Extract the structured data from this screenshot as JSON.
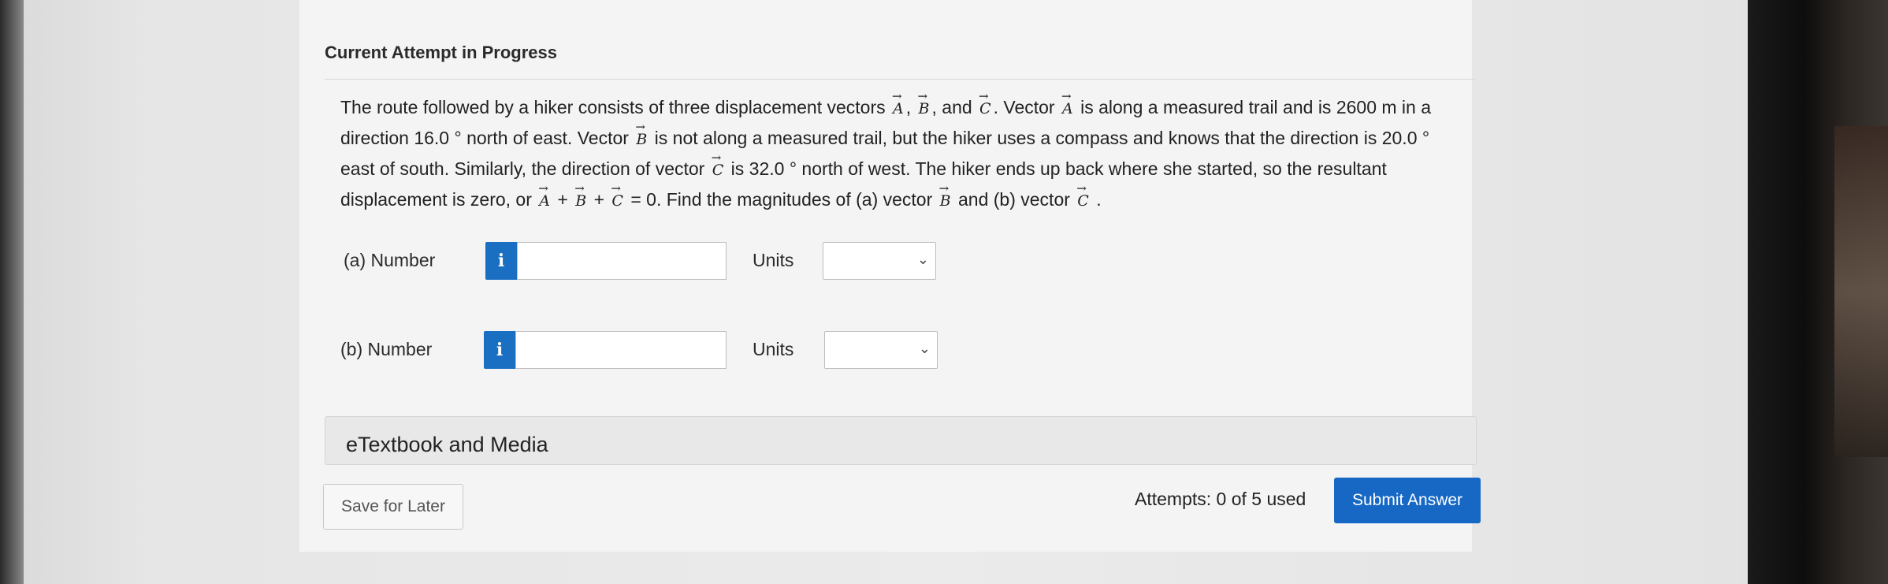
{
  "header": {
    "title": "Current Attempt in Progress"
  },
  "question": {
    "seg1": "The route followed by a hiker consists of three displacement vectors ",
    "seg2": ", ",
    "seg3": ", and ",
    "seg4": ". Vector ",
    "seg5": " is along a measured trail and is 2600 m in a direction 16.0 ° north of east. Vector ",
    "seg6": " is not along a measured trail, but the hiker uses a compass and knows that the direction is 20.0 ° east of south. Similarly, the direction of vector ",
    "seg7": " is 32.0 ° north of west. The hiker ends up back where she started, so the resultant displacement is zero, or ",
    "seg8": " + ",
    "seg9": " + ",
    "seg10": " = 0. Find the magnitudes of (a) vector ",
    "seg11": " and (b) vector ",
    "seg12": " .",
    "vec_a": "A",
    "vec_b": "B",
    "vec_c": "C"
  },
  "part_a": {
    "label": "(a)  Number",
    "info_icon": "i",
    "number_value": "",
    "units_label": "Units",
    "units_value": ""
  },
  "part_b": {
    "label": "(b)  Number",
    "info_icon": "i",
    "number_value": "",
    "units_label": "Units",
    "units_value": ""
  },
  "etextbook": {
    "label": "eTextbook and Media"
  },
  "footer": {
    "save_label": "Save for Later",
    "attempts_text": "Attempts: 0 of 5 used",
    "submit_label": "Submit Answer"
  },
  "colors": {
    "accent_blue": "#1668c4",
    "info_blue": "#1a6fc2"
  }
}
